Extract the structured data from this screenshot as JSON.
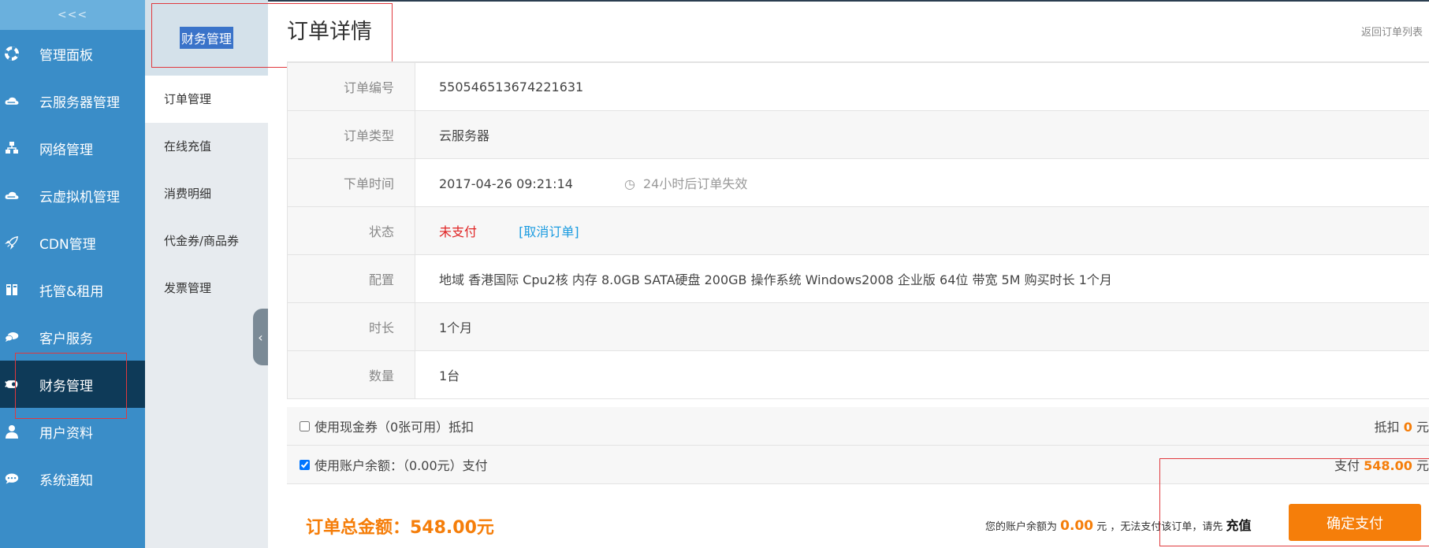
{
  "nav": {
    "collapse_label": "<<<",
    "items": [
      {
        "label": "管理面板",
        "icon": "lifebuoy-icon"
      },
      {
        "label": "云服务器管理",
        "icon": "cloud-icon"
      },
      {
        "label": "网络管理",
        "icon": "network-icon"
      },
      {
        "label": "云虚拟机管理",
        "icon": "cloud-vm-icon"
      },
      {
        "label": "CDN管理",
        "icon": "rocket-icon"
      },
      {
        "label": "托管&租用",
        "icon": "server-icon"
      },
      {
        "label": "客户服务",
        "icon": "chat-bubbles-icon"
      },
      {
        "label": "财务管理",
        "icon": "finance-icon",
        "active": true
      },
      {
        "label": "用户资料",
        "icon": "user-icon"
      },
      {
        "label": "系统通知",
        "icon": "notice-bubble-icon"
      }
    ]
  },
  "subnav": {
    "title": "财务管理",
    "items": [
      {
        "label": "订单管理",
        "active": true
      },
      {
        "label": "在线充值"
      },
      {
        "label": "消费明细"
      },
      {
        "label": "代金券/商品券"
      },
      {
        "label": "发票管理"
      }
    ],
    "toggle_label": "‹"
  },
  "page": {
    "title": "订单详情",
    "back_link": "返回订单列表"
  },
  "details": {
    "order_no_label": "订单编号",
    "order_no": "550546513674221631",
    "type_label": "订单类型",
    "type": "云服务器",
    "time_label": "下单时间",
    "time": "2017-04-26 09:21:14",
    "expire_note": "24小时后订单失效",
    "status_label": "状态",
    "status": "未支付",
    "cancel_link": "[取消订单]",
    "config_label": "配置",
    "config": "地域 香港国际 Cpu2核 内存 8.0GB SATA硬盘 200GB 操作系统 Windows2008 企业版 64位 带宽 5M 购买时长 1个月",
    "duration_label": "时长",
    "duration": "1个月",
    "qty_label": "数量",
    "qty": "1台"
  },
  "payment": {
    "coupon_label": "使用现金券（0张可用）抵扣",
    "coupon_checked": false,
    "deduct_label": "抵扣",
    "deduct_amount": "0",
    "yuan": "元",
    "balance_label": "使用账户余额：（0.00元）支付",
    "balance_checked": true,
    "pay_label": "支付",
    "pay_amount": "548.00"
  },
  "footer": {
    "total_label": "订单总金额：548.00元",
    "notice_prefix": "您的账户余额为",
    "balance_amount": "0.00",
    "notice_middle": "元 ，无法支付该订单，请先",
    "recharge_link": "充值",
    "pay_button": "确定支付"
  },
  "colors": {
    "nav_bg": "#3a8dc8",
    "nav_active": "#0e3a58",
    "accent_orange": "#f57e0a",
    "link_blue": "#1a9be0",
    "status_red": "#e02424",
    "highlight_red": "#e0393e"
  }
}
